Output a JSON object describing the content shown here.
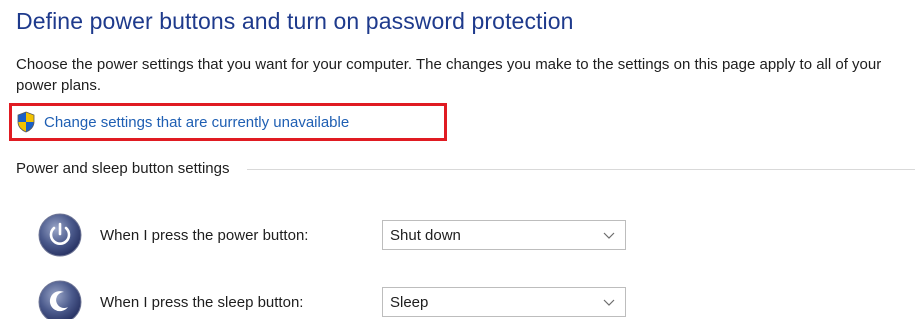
{
  "page": {
    "title": "Define power buttons and turn on password protection",
    "description": "Choose the power settings that you want for your computer. The changes you make to the settings on this page apply to all of your power plans."
  },
  "change_settings_link": {
    "label": "Change settings that are currently unavailable",
    "icon": "uac-shield-icon"
  },
  "power_sleep_group": {
    "header": "Power and sleep button settings",
    "rows": [
      {
        "label": "When I press the power button:",
        "value": "Shut down",
        "icon": "power-button-icon"
      },
      {
        "label": "When I press the sleep button:",
        "value": "Sleep",
        "icon": "sleep-button-icon"
      }
    ]
  },
  "colors": {
    "title": "#1e3a8c",
    "link": "#1f5fb3",
    "highlight_box": "#e01b22",
    "text": "#1e1e1e"
  }
}
